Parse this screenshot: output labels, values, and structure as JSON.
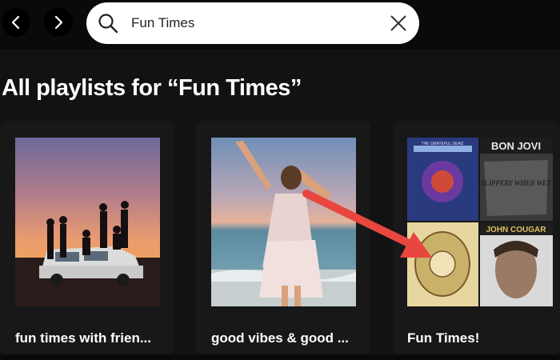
{
  "nav": {
    "back_icon": "chevron-left-icon",
    "forward_icon": "chevron-right-icon"
  },
  "search": {
    "value": "Fun Times",
    "search_icon": "search-icon",
    "clear_icon": "close-icon"
  },
  "results": {
    "title": "All playlists for “Fun Times”",
    "playlists": [
      {
        "title": "fun times with frien..."
      },
      {
        "title": "good vibes & good ..."
      },
      {
        "title": "Fun Times!"
      }
    ]
  },
  "album_text": {
    "band": "BON JOVI",
    "artist": "JOHN COUGAR",
    "tile_1_text": "THE GRATEFUL DEAD",
    "tile_2_text": "SLIPPERY WHEN WET"
  },
  "colors": {
    "background": "#121212",
    "card": "#181818",
    "search_bg": "#ffffff",
    "arrow": "#e8463f"
  }
}
